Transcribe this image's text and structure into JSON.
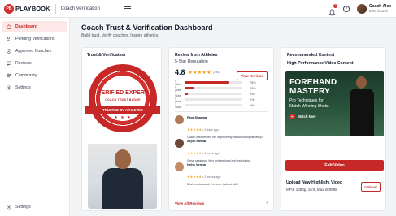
{
  "header": {
    "logo_initials": "PB",
    "logo_text": "PLAYBOOK",
    "app_name": "Coach Verification",
    "notification_count": "3",
    "help_glyph": "?",
    "user_name": "Coach Alex",
    "user_role": "Elite Coach"
  },
  "sidebar": {
    "items": [
      {
        "label": "Dashboard",
        "icon": "home-icon",
        "active": true
      },
      {
        "label": "Pending Verifications",
        "icon": "user-clock-icon",
        "active": false
      },
      {
        "label": "Approved Coaches",
        "icon": "user-check-icon",
        "active": false
      },
      {
        "label": "Reviews",
        "icon": "chat-icon",
        "active": false
      },
      {
        "label": "Community",
        "icon": "people-icon",
        "active": false
      },
      {
        "label": "Settings",
        "icon": "gear-icon",
        "active": false
      }
    ],
    "bottom_settings": "Settings"
  },
  "page": {
    "title": "Coach Trust & Verification Dashboard",
    "subtitle": "Build trust. Verify coaches. Inspire athletes."
  },
  "trust": {
    "title": "Trust & Verification",
    "badge_line1": "VERIFIED EXPERT",
    "badge_line2": "COACH TRUST BADGE",
    "ribbon": "TRUSTED BY ATHLETES",
    "stars": "★ ★ ★"
  },
  "reviews": {
    "title": "Review from Athletes",
    "reputation_label": "5-Star Reputation",
    "rating": "4.8",
    "stars": "★★★★★",
    "count": "(156)",
    "view_button": "View Reviews",
    "distribution": [
      {
        "label": "5 Star",
        "pct": "78%",
        "value": 0.78
      },
      {
        "label": "4 Star",
        "pct": "15%",
        "value": 0.15
      },
      {
        "label": "3 Star",
        "pct": "5%",
        "value": 0.05
      },
      {
        "label": "2 Star",
        "pct": "1%",
        "value": 0.01
      },
      {
        "label": "1 Star",
        "pct": "0%",
        "value": 0.0
      }
    ],
    "items": [
      {
        "name": "Riya Sharma",
        "stars": "★★★★★",
        "time": "• 2 days ago",
        "text": "Coach Alex helped me improve my backhand significantly!",
        "color": "#b07a5a"
      },
      {
        "name": "Arjun Mehta",
        "stars": "★★★★★",
        "time": "• 1 week ago",
        "text": "Great sessions! Very professional and motivating.",
        "color": "#6b4a3a"
      },
      {
        "name": "Neha Verma",
        "stars": "★★★★★",
        "time": "• 2 weeks ago",
        "text": "Best tennis coach I've ever trained with!",
        "color": "#c48b6a"
      }
    ],
    "view_all": "View All Reviews",
    "chevron": "›"
  },
  "recommended": {
    "title": "Recommended Content",
    "subtitle": "High-Performance Video Content",
    "video_title_1": "FOREHAND",
    "video_title_2": "MASTERY",
    "video_sub_1": "Pro Techniques for",
    "video_sub_2": "Match-Winning Shots",
    "watch_now": "Watch Now",
    "edit_button": "Edit Video",
    "upload_title": "Upload New Highlight Video",
    "upload_desc": "MP4, 1080p, 16:9, Max 200MB",
    "upload_button": "Upload"
  },
  "colors": {
    "accent": "#c62828",
    "star": "#f59e0b"
  }
}
